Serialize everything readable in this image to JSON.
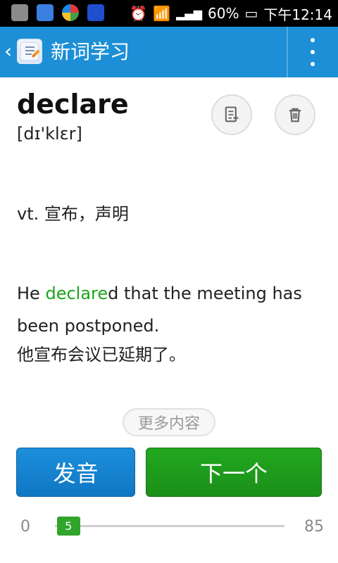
{
  "status_bar": {
    "battery_percent": "60%",
    "time": "下午12:14",
    "icons": [
      "notification-icon",
      "contact-icon",
      "app-icon",
      "android-icon",
      "alarm-icon",
      "wifi-icon",
      "signal-icon",
      "battery-icon"
    ]
  },
  "app_bar": {
    "title": "新词学习",
    "back_icon": "chevron-left-icon",
    "menu_icon": "overflow-menu-icon",
    "accent_color": "#1c8fd6"
  },
  "word": {
    "headword": "declare",
    "phonetic": "[dɪ'klɛr]"
  },
  "definition": {
    "text": "vt. 宣布，声明"
  },
  "example": {
    "before": "He ",
    "highlight": "declare",
    "after": "d that the meeting has been postponed.",
    "translation": "他宣布会议已延期了。",
    "highlight_color": "#19a51a"
  },
  "more_button": {
    "label": "更多内容"
  },
  "actions": {
    "pronounce_label": "发音",
    "next_label": "下一个",
    "pronounce_color": "#1a86d4",
    "next_color": "#1f9c1d"
  },
  "progress": {
    "min": "0",
    "max": "85",
    "current": "5",
    "fraction": 0.0588
  }
}
